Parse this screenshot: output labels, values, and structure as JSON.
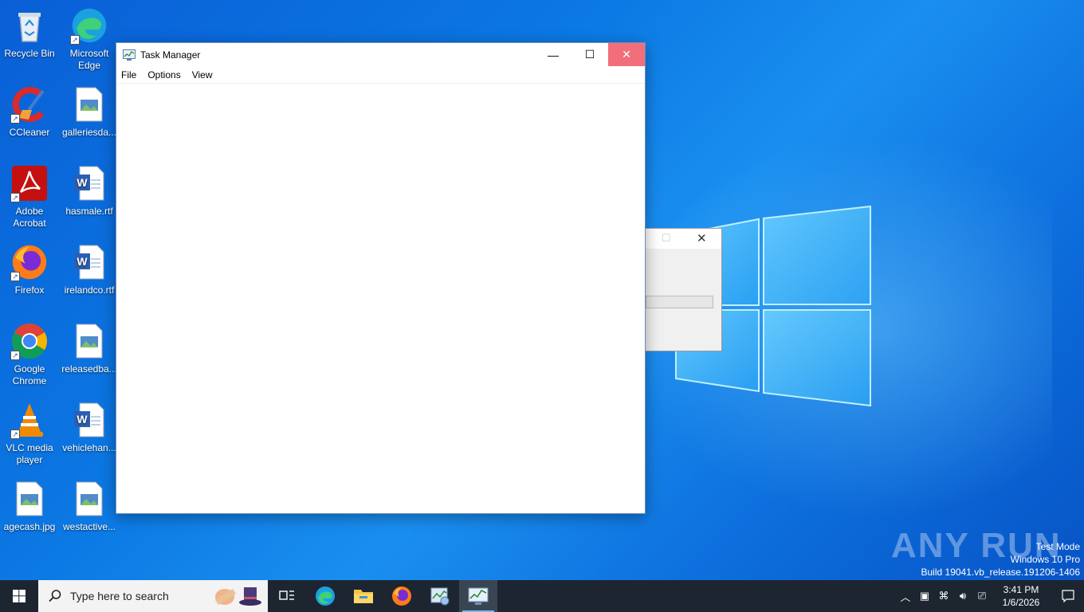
{
  "desktop": {
    "icons": [
      {
        "label": "Recycle Bin",
        "icon": "recycle-bin-icon"
      },
      {
        "label": "Microsoft Edge",
        "icon": "edge-icon"
      },
      {
        "label": "CCleaner",
        "icon": "ccleaner-icon"
      },
      {
        "label": "galleriesda...",
        "icon": "image-file-icon"
      },
      {
        "label": "Adobe Acrobat",
        "icon": "acrobat-icon"
      },
      {
        "label": "hasmale.rtf",
        "icon": "word-doc-icon"
      },
      {
        "label": "Firefox",
        "icon": "firefox-icon"
      },
      {
        "label": "irelandco.rtf",
        "icon": "word-doc-icon"
      },
      {
        "label": "Google Chrome",
        "icon": "chrome-icon"
      },
      {
        "label": "releasedba...",
        "icon": "image-file-icon"
      },
      {
        "label": "VLC media player",
        "icon": "vlc-icon"
      },
      {
        "label": "vehiclehan...",
        "icon": "word-doc-icon"
      },
      {
        "label": "agecash.jpg",
        "icon": "image-file-icon"
      },
      {
        "label": "westactive...",
        "icon": "image-file-icon"
      }
    ]
  },
  "window": {
    "title": "Task Manager",
    "minimize_glyph": "—",
    "maximize_glyph": "☐",
    "close_glyph": "✕",
    "menu": [
      "File",
      "Options",
      "View"
    ]
  },
  "dialog": {
    "max_glyph": "☐",
    "close_glyph": "✕"
  },
  "watermark": {
    "brand": "ANY RUN",
    "line1": "Test Mode",
    "line2": "Windows 10 Pro",
    "line3": "Build 19041.vb_release.191206-1406"
  },
  "taskbar": {
    "search_placeholder": "Type here to search",
    "time": "3:41 PM",
    "date": "1/6/2026",
    "colors": {
      "taskbar": "#1c2530",
      "accent": "#76b9ed",
      "close": "#e81123"
    }
  }
}
